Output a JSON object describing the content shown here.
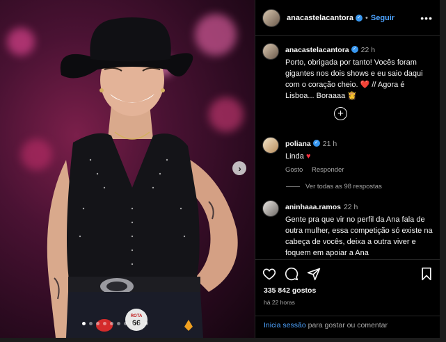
{
  "post": {
    "username": "anacastelacantora",
    "follow_label": "Seguir",
    "separator": "•",
    "more_label": "•••"
  },
  "carousel": {
    "total_slides": 10,
    "active_index": 0,
    "next_label": "›",
    "badge_text": "66",
    "badge_sub": "ROTA"
  },
  "caption": {
    "username": "anacastelacantora",
    "time": "22 h",
    "text": "Porto, obrigada por tanto! Vocês foram gigantes nos dois shows e eu saio daqui com o coração cheio. ❤️ // Agora é Lisboa... Boraaaa 👸"
  },
  "load_more_label": "+",
  "comments": [
    {
      "username": "poliana",
      "verified": true,
      "time": "21 h",
      "text": "Linda",
      "emoji": "♥",
      "like_label": "Gosto",
      "reply_label": "Responder",
      "view_replies": "Ver todas as 98 respostas"
    },
    {
      "username": "aninhaaa.ramos",
      "verified": false,
      "time": "22 h",
      "text": "Gente pra que vir no perfil da Ana fala de outra mulher, essa competição só existe na cabeça de vocês, deixa a outra viver e foquem em apoiar a Ana"
    }
  ],
  "footer": {
    "likes": "335 842 gostos",
    "time_ago": "há 22 horas",
    "login_link": "Inicia sessão",
    "login_text": " para gostar ou comentar"
  },
  "colors": {
    "link": "#4da3ff",
    "verified": "#3897f0",
    "like_red": "#ff3040"
  }
}
